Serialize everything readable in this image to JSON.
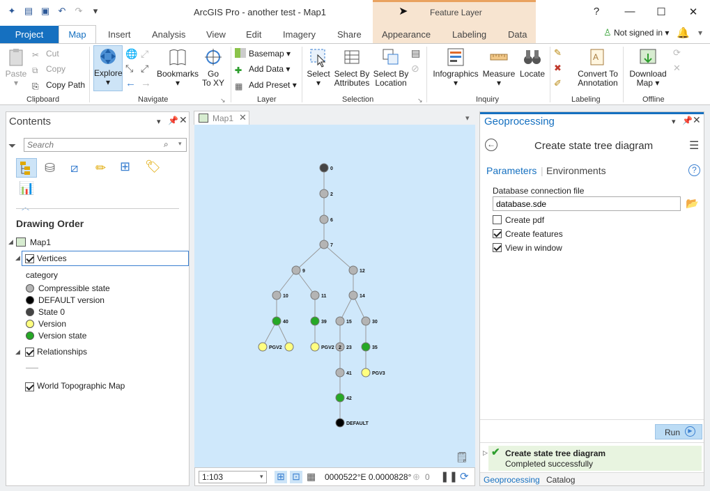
{
  "app": {
    "title": "ArcGIS Pro - another test - Map1",
    "contextual_tab_group": "Feature Layer",
    "sign_in": "Not signed in"
  },
  "window": {
    "help": "?",
    "minimize": "—",
    "maximize": "☐",
    "close": "✕"
  },
  "tabs": [
    "Project",
    "Map",
    "Insert",
    "Analysis",
    "View",
    "Edit",
    "Imagery",
    "Share",
    "Appearance",
    "Labeling",
    "Data"
  ],
  "ribbon": {
    "clipboard": {
      "group": "Clipboard",
      "paste": "Paste",
      "cut": "Cut",
      "copy": "Copy",
      "copy_path": "Copy Path"
    },
    "navigate": {
      "group": "Navigate",
      "explore": "Explore",
      "bookmarks": "Bookmarks",
      "go_to_xy_1": "Go",
      "go_to_xy_2": "To XY"
    },
    "layer": {
      "group": "Layer",
      "basemap": "Basemap",
      "add_data": "Add Data",
      "add_preset": "Add Preset"
    },
    "selection": {
      "group": "Selection",
      "select": "Select",
      "by_attr_1": "Select By",
      "by_attr_2": "Attributes",
      "by_loc_1": "Select By",
      "by_loc_2": "Location"
    },
    "inquiry": {
      "group": "Inquiry",
      "infographics": "Infographics",
      "measure": "Measure",
      "locate": "Locate"
    },
    "labeling": {
      "group": "Labeling",
      "convert_1": "Convert To",
      "convert_2": "Annotation"
    },
    "offline": {
      "group": "Offline",
      "download_1": "Download",
      "download_2": "Map"
    }
  },
  "contents": {
    "title": "Contents",
    "search_placeholder": "Search",
    "drawing_order": "Drawing Order",
    "map_name": "Map1",
    "layer_vertices": "Vertices",
    "category_label": "category",
    "legend": [
      {
        "label": "Compressible state",
        "color": "#b4b4b4"
      },
      {
        "label": "DEFAULT version",
        "color": "#000000"
      },
      {
        "label": "State 0",
        "color": "#444444"
      },
      {
        "label": "Version",
        "color": "#ffff80"
      },
      {
        "label": "Version state",
        "color": "#26a826"
      }
    ],
    "layer_relationships": "Relationships",
    "layer_basemap": "World Topographic Map"
  },
  "mapview": {
    "tab": "Map1",
    "scale": "1:103",
    "coords": "0000522°E 0.0000828°",
    "selected_count": "0"
  },
  "geoprocessing": {
    "title": "Geoprocessing",
    "tool_name": "Create state tree diagram",
    "tab_parameters": "Parameters",
    "tab_environments": "Environments",
    "db_label": "Database connection file",
    "db_value": "database.sde",
    "opt_pdf": "Create pdf",
    "opt_features": "Create features",
    "opt_window": "View in window",
    "run": "Run",
    "status_title": "Create state tree diagram",
    "status_msg": "Completed successfully",
    "bottom_tab_geo": "Geoprocessing",
    "bottom_tab_catalog": "Catalog"
  },
  "colors": {
    "accent": "#1570c0",
    "map_bg": "#cfe8fb",
    "version_state": "#26a826",
    "version": "#ffff80",
    "compressible": "#b4b4b4",
    "success": "#2e9e2e"
  },
  "chart_data": {
    "type": "tree",
    "nodes": [
      {
        "id": "0",
        "cat": "State 0"
      },
      {
        "id": "2",
        "cat": "Compressible state"
      },
      {
        "id": "6",
        "cat": "Compressible state"
      },
      {
        "id": "7",
        "cat": "Compressible state"
      },
      {
        "id": "9",
        "cat": "Compressible state"
      },
      {
        "id": "12",
        "cat": "Compressible state"
      },
      {
        "id": "10",
        "cat": "Compressible state"
      },
      {
        "id": "11",
        "cat": "Compressible state"
      },
      {
        "id": "14",
        "cat": "Compressible state"
      },
      {
        "id": "40",
        "cat": "Version state"
      },
      {
        "id": "39",
        "cat": "Version state"
      },
      {
        "id": "15",
        "cat": "Compressible state"
      },
      {
        "id": "30",
        "cat": "Compressible state"
      },
      {
        "id": "PGV2",
        "cat": "Version"
      },
      {
        "id": "PGV2b",
        "label": "PGV2",
        "cat": "Version"
      },
      {
        "id": "2b",
        "label": "2",
        "cat": "Compressible state"
      },
      {
        "id": "23",
        "cat": "Compressible state"
      },
      {
        "id": "35",
        "cat": "Version state"
      },
      {
        "id": "41",
        "cat": "Compressible state"
      },
      {
        "id": "PGV3",
        "cat": "Version"
      },
      {
        "id": "42",
        "cat": "Version state"
      },
      {
        "id": "DEFAULT",
        "cat": "DEFAULT version"
      }
    ]
  }
}
